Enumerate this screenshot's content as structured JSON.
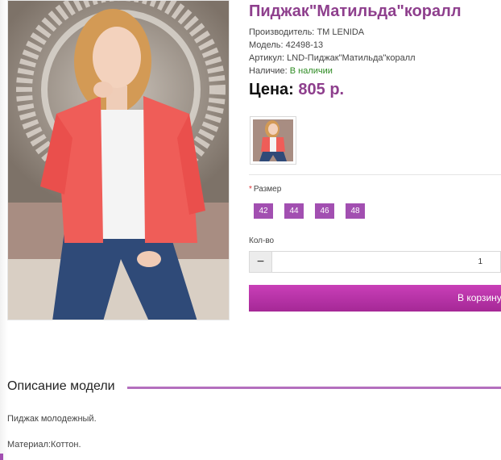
{
  "product": {
    "title": "Пиджак\"Матильда\"коралл",
    "manufacturer_label": "Производитель:",
    "manufacturer": "TM LENIDA",
    "model_label": "Модель:",
    "model": "42498-13",
    "article_label": "Артикул:",
    "article": "LND-Пиджак\"Матильда\"коралл",
    "availability_label": "Наличие:",
    "availability": "В наличии",
    "price_label": "Цена:",
    "price": "805 р."
  },
  "options": {
    "size_label": "Размер",
    "required_mark": "*",
    "sizes": [
      "42",
      "44",
      "46",
      "48"
    ]
  },
  "quantity": {
    "label": "Кол-во",
    "minus": "−",
    "value": "1"
  },
  "cart": {
    "button_label": "В корзину"
  },
  "description": {
    "title": "Описание модели",
    "line1": "Пиджак молодежный.",
    "line2": "Материал:Коттон."
  },
  "colors": {
    "accent": "#8e3f8d",
    "button": "#a24fb1",
    "available": "#2e8b23"
  }
}
